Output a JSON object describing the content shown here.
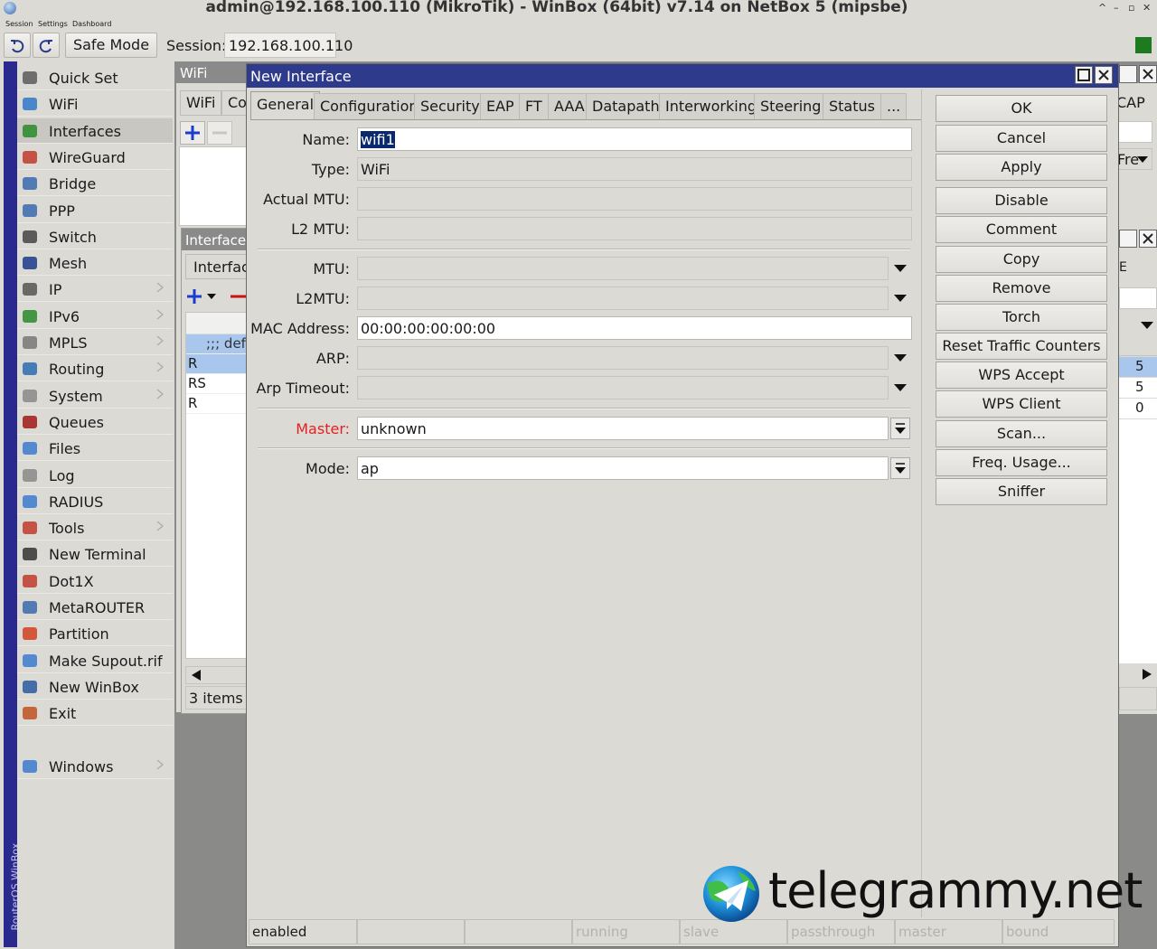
{
  "window": {
    "title": "admin@192.168.100.110 (MikroTik) - WinBox (64bit) v7.14 on NetBox 5 (mipsbe)",
    "controls": [
      "^",
      "–",
      "▫",
      "✕"
    ]
  },
  "menubar": [
    "Session",
    "Settings",
    "Dashboard"
  ],
  "toolbar": {
    "safe_mode": "Safe Mode",
    "session_label": "Session:",
    "session_value": "192.168.100.110",
    "status_color": "#1e7a1e"
  },
  "side_strip_label": "RouterOS WinBox",
  "menu": [
    {
      "label": "Quick Set",
      "icon": "quick-set-icon",
      "arrow": false
    },
    {
      "label": "WiFi",
      "icon": "wifi-icon",
      "arrow": false
    },
    {
      "label": "Interfaces",
      "icon": "interfaces-icon",
      "arrow": false
    },
    {
      "label": "WireGuard",
      "icon": "wireguard-icon",
      "arrow": false
    },
    {
      "label": "Bridge",
      "icon": "bridge-icon",
      "arrow": false
    },
    {
      "label": "PPP",
      "icon": "ppp-icon",
      "arrow": false
    },
    {
      "label": "Switch",
      "icon": "switch-icon",
      "arrow": false
    },
    {
      "label": "Mesh",
      "icon": "mesh-icon",
      "arrow": false
    },
    {
      "label": "IP",
      "icon": "ip-icon",
      "arrow": true
    },
    {
      "label": "IPv6",
      "icon": "ipv6-icon",
      "arrow": true
    },
    {
      "label": "MPLS",
      "icon": "mpls-icon",
      "arrow": true
    },
    {
      "label": "Routing",
      "icon": "routing-icon",
      "arrow": true
    },
    {
      "label": "System",
      "icon": "system-icon",
      "arrow": true
    },
    {
      "label": "Queues",
      "icon": "queues-icon",
      "arrow": false
    },
    {
      "label": "Files",
      "icon": "files-icon",
      "arrow": false
    },
    {
      "label": "Log",
      "icon": "log-icon",
      "arrow": false
    },
    {
      "label": "RADIUS",
      "icon": "radius-icon",
      "arrow": false
    },
    {
      "label": "Tools",
      "icon": "tools-icon",
      "arrow": true
    },
    {
      "label": "New Terminal",
      "icon": "terminal-icon",
      "arrow": false
    },
    {
      "label": "Dot1X",
      "icon": "dot1x-icon",
      "arrow": false
    },
    {
      "label": "MetaROUTER",
      "icon": "metarouter-icon",
      "arrow": false
    },
    {
      "label": "Partition",
      "icon": "partition-icon",
      "arrow": false
    },
    {
      "label": "Make Supout.rif",
      "icon": "supout-icon",
      "arrow": false
    },
    {
      "label": "New WinBox",
      "icon": "winbox-icon",
      "arrow": false
    },
    {
      "label": "Exit",
      "icon": "exit-icon",
      "arrow": false
    },
    {
      "label": "Windows",
      "icon": "windows-icon",
      "arrow": true
    }
  ],
  "wifi_window": {
    "title": "WiFi",
    "tabs": [
      "WiFi",
      "Co"
    ]
  },
  "interface_window": {
    "title": "Interface",
    "tab": "Interfac",
    "rows": [
      ";;; def",
      "R",
      "RS",
      "R"
    ],
    "items": "3 items ("
  },
  "right_remnants": {
    "cap": "CAP",
    "fre": "Fre",
    "e": "E",
    "numbers": [
      "5",
      "5",
      "0"
    ]
  },
  "dialog": {
    "title": "New Interface",
    "tabs": [
      "General",
      "Configuration",
      "Security",
      "EAP",
      "FT",
      "AAA",
      "Datapath",
      "Interworking",
      "Steering",
      "Status",
      "..."
    ],
    "fields": {
      "name": {
        "label": "Name:",
        "value": "wifi1"
      },
      "type": {
        "label": "Type:",
        "value": "WiFi"
      },
      "actual_mtu": {
        "label": "Actual MTU:",
        "value": ""
      },
      "l2_mtu": {
        "label": "L2 MTU:",
        "value": ""
      },
      "mtu": {
        "label": "MTU:",
        "value": ""
      },
      "l2mtu": {
        "label": "L2MTU:",
        "value": ""
      },
      "mac": {
        "label": "MAC Address:",
        "value": "00:00:00:00:00:00"
      },
      "arp": {
        "label": "ARP:",
        "value": ""
      },
      "arp_timeout": {
        "label": "Arp Timeout:",
        "value": ""
      },
      "master": {
        "label": "Master:",
        "value": "unknown"
      },
      "mode": {
        "label": "Mode:",
        "value": "ap"
      }
    },
    "buttons": [
      "OK",
      "Cancel",
      "Apply",
      "Disable",
      "Comment",
      "Copy",
      "Remove",
      "Torch",
      "Reset Traffic Counters",
      "WPS Accept",
      "WPS Client",
      "Scan...",
      "Freq. Usage...",
      "Sniffer"
    ],
    "status": [
      "enabled",
      "",
      "",
      "running",
      "slave",
      "passthrough",
      "master",
      "bound"
    ]
  },
  "watermark": "telegrammy.net"
}
